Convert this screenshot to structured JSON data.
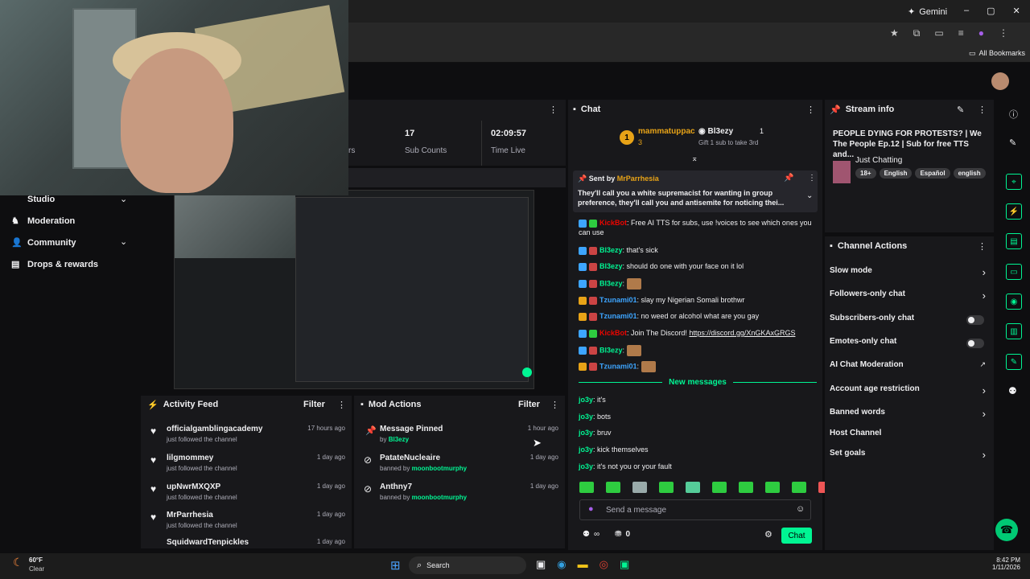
{
  "browser": {
    "gemini_label": "Gemini",
    "bookmarks_label": "All Bookmarks"
  },
  "sidebar": {
    "items": [
      {
        "label": "Studio"
      },
      {
        "label": "Moderation"
      },
      {
        "label": "Community"
      },
      {
        "label": "Drops & rewards"
      }
    ]
  },
  "stats": {
    "sub_counts_value": "17",
    "sub_counts_label": "Sub Counts",
    "time_live_value": "02:09:57",
    "time_live_label": "Time Live",
    "partial_label": "rs"
  },
  "activity_feed": {
    "title": "Activity Feed",
    "filter": "Filter",
    "rows": [
      {
        "name": "officialgamblingacademy",
        "sub": "just followed the channel",
        "time": "17 hours ago"
      },
      {
        "name": "lilgmommey",
        "sub": "just followed the channel",
        "time": "1 day ago"
      },
      {
        "name": "upNwrMXQXP",
        "sub": "just followed the channel",
        "time": "1 day ago"
      },
      {
        "name": "MrParrhesia",
        "sub": "just followed the channel",
        "time": "1 day ago"
      },
      {
        "name": "SquidwardTenpickles",
        "sub": "",
        "time": "1 day ago"
      }
    ]
  },
  "mod_actions": {
    "title": "Mod Actions",
    "filter": "Filter",
    "rows": [
      {
        "name": "Message Pinned",
        "by_prefix": "by",
        "by": "Bl3ezy",
        "time": "1 hour ago"
      },
      {
        "name": "PatateNucleaire",
        "by_prefix": "banned by",
        "by": "moonbootmurphy",
        "time": "1 day ago"
      },
      {
        "name": "Anthny7",
        "by_prefix": "banned by",
        "by": "moonbootmurphy",
        "time": "1 day ago"
      }
    ]
  },
  "chat": {
    "title": "Chat",
    "leaderboard": {
      "first_name": "mammatuppac",
      "first_count": "3",
      "second_name": "Bl3ezy",
      "second_count": "1",
      "second_note": "Gift 1 sub to take 3rd"
    },
    "pinned": {
      "sent_by_prefix": "Sent by",
      "sent_by": "MrParrhesia",
      "text": "They'll call you a white supremacist for wanting in group preference, they'll call you and antisemite for noticing thei..."
    },
    "messages": [
      {
        "user": "KickBot",
        "text": "Free AI TTS for subs, use !voices to see which ones you can use",
        "color": "#eb0400"
      },
      {
        "user": "Bl3ezy",
        "text": "that's sick",
        "color": "#00f593"
      },
      {
        "user": "Bl3ezy",
        "text": "should do one with your face on it lol",
        "color": "#00f593"
      },
      {
        "user": "Bl3ezy",
        "text": "",
        "color": "#00f593"
      },
      {
        "user": "Tzunami01",
        "text": "slay my Nigerian Somali brothwr",
        "color": "#3da5ff"
      },
      {
        "user": "Tzunami01",
        "text": "no weed or alcohol what are you gay",
        "color": "#3da5ff"
      },
      {
        "user": "KickBot",
        "text": "Join The Discord!",
        "link": "https://discord.gg/XnGKAxGRGS",
        "color": "#eb0400"
      },
      {
        "user": "Bl3ezy",
        "text": "",
        "color": "#00f593"
      },
      {
        "user": "Tzunami01",
        "text": "",
        "color": "#3da5ff"
      }
    ],
    "new_messages_label": "New messages",
    "new_messages": [
      {
        "user": "jo3y",
        "text": "it's"
      },
      {
        "user": "jo3y",
        "text": "bots"
      },
      {
        "user": "jo3y",
        "text": "bruv"
      },
      {
        "user": "jo3y",
        "text": "kick themselves"
      },
      {
        "user": "jo3y",
        "text": "it's not you or your fault"
      }
    ],
    "input_placeholder": "Send a message",
    "points": "0",
    "send_label": "Chat"
  },
  "stream_info": {
    "title": "Stream info",
    "stream_title": "PEOPLE DYING FOR PROTESTS? | We The People Ep.12 | Sub for free TTS and...",
    "category": "Just Chatting",
    "tags": [
      "18+",
      "English",
      "Español",
      "english"
    ]
  },
  "channel_actions": {
    "title": "Channel Actions",
    "items": [
      {
        "label": "Slow mode",
        "control": "chevron"
      },
      {
        "label": "Followers-only chat",
        "control": "chevron"
      },
      {
        "label": "Subscribers-only chat",
        "control": "toggle"
      },
      {
        "label": "Emotes-only chat",
        "control": "toggle"
      },
      {
        "label": "AI Chat Moderation",
        "control": "link"
      },
      {
        "label": "Account age restriction",
        "control": "chevron"
      },
      {
        "label": "Banned words",
        "control": "chevron"
      },
      {
        "label": "Host Channel",
        "control": "none"
      },
      {
        "label": "Set goals",
        "control": "chevron"
      }
    ]
  },
  "taskbar": {
    "weather_temp": "60°F",
    "weather_desc": "Clear",
    "search_label": "Search",
    "time": "8:42 PM",
    "date": "1/11/2026"
  }
}
